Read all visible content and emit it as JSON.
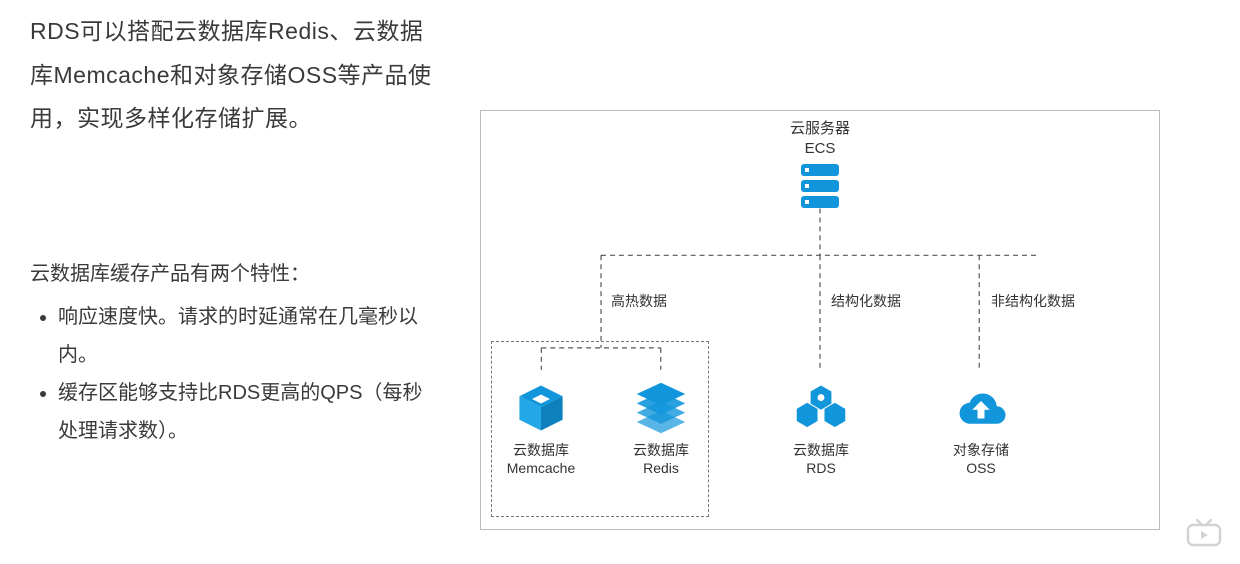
{
  "intro": "RDS可以搭配云数据库Redis、云数据库Memcache和对象存储OSS等产品使用，实现多样化存储扩展。",
  "subhead": "云数据库缓存产品有两个特性：",
  "features": [
    "响应速度快。请求的时延通常在几毫秒以内。",
    "缓存区能够支持比RDS更高的QPS（每秒处理请求数）。"
  ],
  "diagram": {
    "top": {
      "line1": "云服务器",
      "line2": "ECS"
    },
    "branch_labels": {
      "hot": "高热数据",
      "structured": "结构化数据",
      "unstructured": "非结构化数据"
    },
    "services": {
      "memcache": {
        "line1": "云数据库",
        "line2": "Memcache"
      },
      "redis": {
        "line1": "云数据库",
        "line2": "Redis"
      },
      "rds": {
        "line1": "云数据库",
        "line2": "RDS"
      },
      "oss": {
        "line1": "对象存储",
        "line2": "OSS"
      }
    }
  },
  "colors": {
    "accent": "#1296db"
  }
}
